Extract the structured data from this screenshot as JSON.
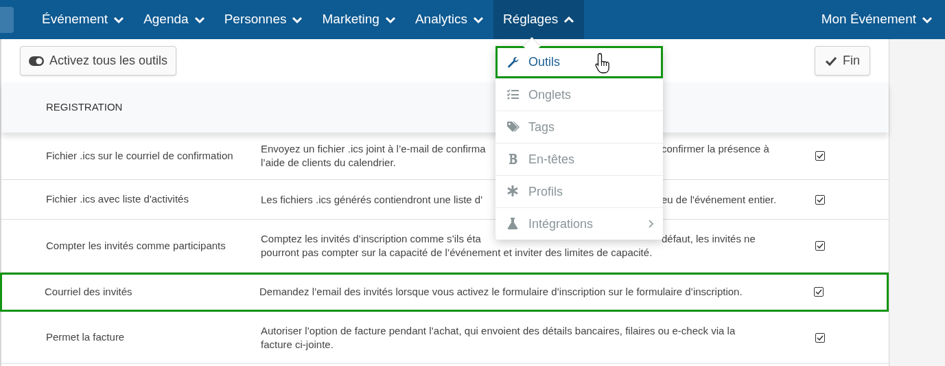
{
  "nav": {
    "items": [
      {
        "label": "Événement",
        "expanded": false
      },
      {
        "label": "Agenda",
        "expanded": false
      },
      {
        "label": "Personnes",
        "expanded": false
      },
      {
        "label": "Marketing",
        "expanded": false
      },
      {
        "label": "Analytics",
        "expanded": false
      },
      {
        "label": "Réglages",
        "expanded": true
      }
    ],
    "event_menu": {
      "label": "Mon Événement",
      "expanded": false
    }
  },
  "toolbar": {
    "enable_all_button": "Activez tous les outils",
    "done_button": "Fin"
  },
  "section_header": "REGISTRATION",
  "rows": [
    {
      "name": "Fichier .ics sur le courriel de confirmation",
      "description_lines": [
        [
          "Envoyez un fichier .ics joint à l’e-mail de confirma",
          "confirmer la présence à"
        ],
        [
          "l’aide de clients du calendrier."
        ]
      ],
      "checked": true,
      "highlighted": false
    },
    {
      "name": "Fichier .ics avec liste d'activités",
      "description_lines": [
        [
          "Les fichiers .ics générés contiendront une liste d'",
          "eu de l'événement entier."
        ]
      ],
      "checked": true,
      "highlighted": false
    },
    {
      "name": "Compter les invités comme participants",
      "description_lines": [
        [
          "Comptez les invités d’inscription comme s’ils éta",
          "défaut, les invités ne"
        ],
        [
          "pourront pas compter sur la capacité de l’événement et inviter des limites de capacité."
        ]
      ],
      "checked": true,
      "highlighted": false
    },
    {
      "name": "Courriel des invités",
      "description_lines": [
        [
          "Demandez l’email des invités lorsque vous activez le formulaire d’inscription sur le formulaire d’inscription."
        ]
      ],
      "checked": true,
      "highlighted": true
    },
    {
      "name": "Permet la facture",
      "description_lines": [
        [
          "Autoriser l’option de facture pendant l’achat, qui envoient des détails bancaires, filaires ou e-check via la"
        ],
        [
          "facture ci-jointe."
        ]
      ],
      "checked": true,
      "highlighted": false
    }
  ],
  "settings_menu": {
    "items": [
      {
        "kind": "wrench",
        "label": "Outils",
        "selected": true,
        "highlighted": true,
        "submenu": false
      },
      {
        "kind": "checklist",
        "label": "Onglets",
        "selected": false,
        "highlighted": false,
        "submenu": false
      },
      {
        "kind": "tags",
        "label": "Tags",
        "selected": false,
        "highlighted": false,
        "submenu": false
      },
      {
        "kind": "bold",
        "label": "En-têtes",
        "selected": false,
        "highlighted": false,
        "submenu": false
      },
      {
        "kind": "asterisk",
        "label": "Profils",
        "selected": false,
        "highlighted": false,
        "submenu": false
      },
      {
        "kind": "flask",
        "label": "Intégrations",
        "selected": false,
        "highlighted": false,
        "submenu": true
      }
    ]
  }
}
